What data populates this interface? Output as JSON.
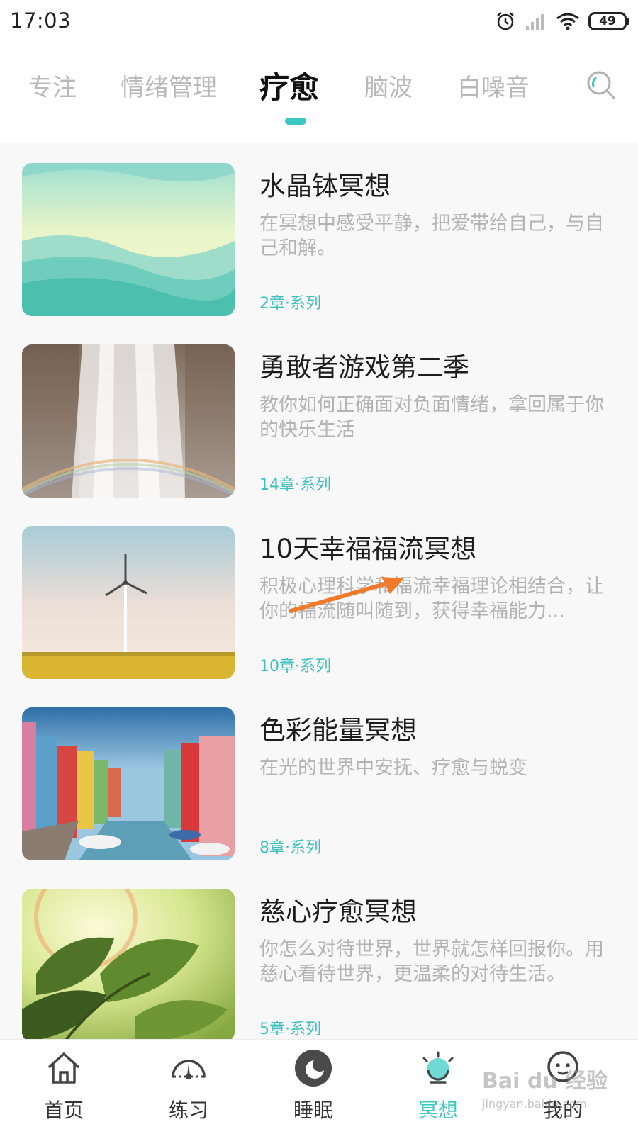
{
  "status_bar": {
    "time": "17:03",
    "battery": "49",
    "icons": [
      "alarm-icon",
      "signal-icon",
      "wifi-icon",
      "battery-icon"
    ]
  },
  "tabs": [
    {
      "label": "专注",
      "active": false
    },
    {
      "label": "情绪管理",
      "active": false
    },
    {
      "label": "疗愈",
      "active": true
    },
    {
      "label": "脑波",
      "active": false
    },
    {
      "label": "白噪音",
      "active": false
    }
  ],
  "colors": {
    "accent": "#3cc7c4",
    "annotation_arrow": "#f07a2c"
  },
  "items": [
    {
      "title": "水晶钵冥想",
      "desc": "在冥想中感受平静，把爱带给自己，与自己和解。",
      "meta": "2章·系列",
      "thumb": "teal-waves"
    },
    {
      "title": "勇敢者游戏第二季",
      "desc": "教你如何正确面对负面情绪，拿回属于你的快乐生活",
      "meta": "14章·系列",
      "thumb": "waterfall-rainbow"
    },
    {
      "title": "10天幸福福流冥想",
      "desc": "积极心理科学和福流幸福理论相结合，让你的福流随叫随到，获得幸福能力...",
      "meta": "10章·系列",
      "thumb": "wind-turbine-field"
    },
    {
      "title": "色彩能量冥想",
      "desc": "在光的世界中安抚、疗愈与蜕变",
      "meta": "8章·系列",
      "thumb": "colorful-canal-town"
    },
    {
      "title": "慈心疗愈冥想",
      "desc": "你怎么对待世界，世界就怎样回报你。用慈心看待世界，更温柔的对待生活。",
      "meta": "5章·系列",
      "thumb": "sunlit-leaves"
    }
  ],
  "nav": [
    {
      "label": "首页",
      "icon": "home-icon",
      "active": false
    },
    {
      "label": "练习",
      "icon": "gauge-icon",
      "active": false
    },
    {
      "label": "睡眠",
      "icon": "moon-icon",
      "active": false
    },
    {
      "label": "冥想",
      "icon": "meditation-icon",
      "active": true
    },
    {
      "label": "我的",
      "icon": "profile-icon",
      "active": false
    }
  ],
  "watermark": {
    "brand": "Bai du 经验",
    "url": "jingyan.baidu.com"
  }
}
